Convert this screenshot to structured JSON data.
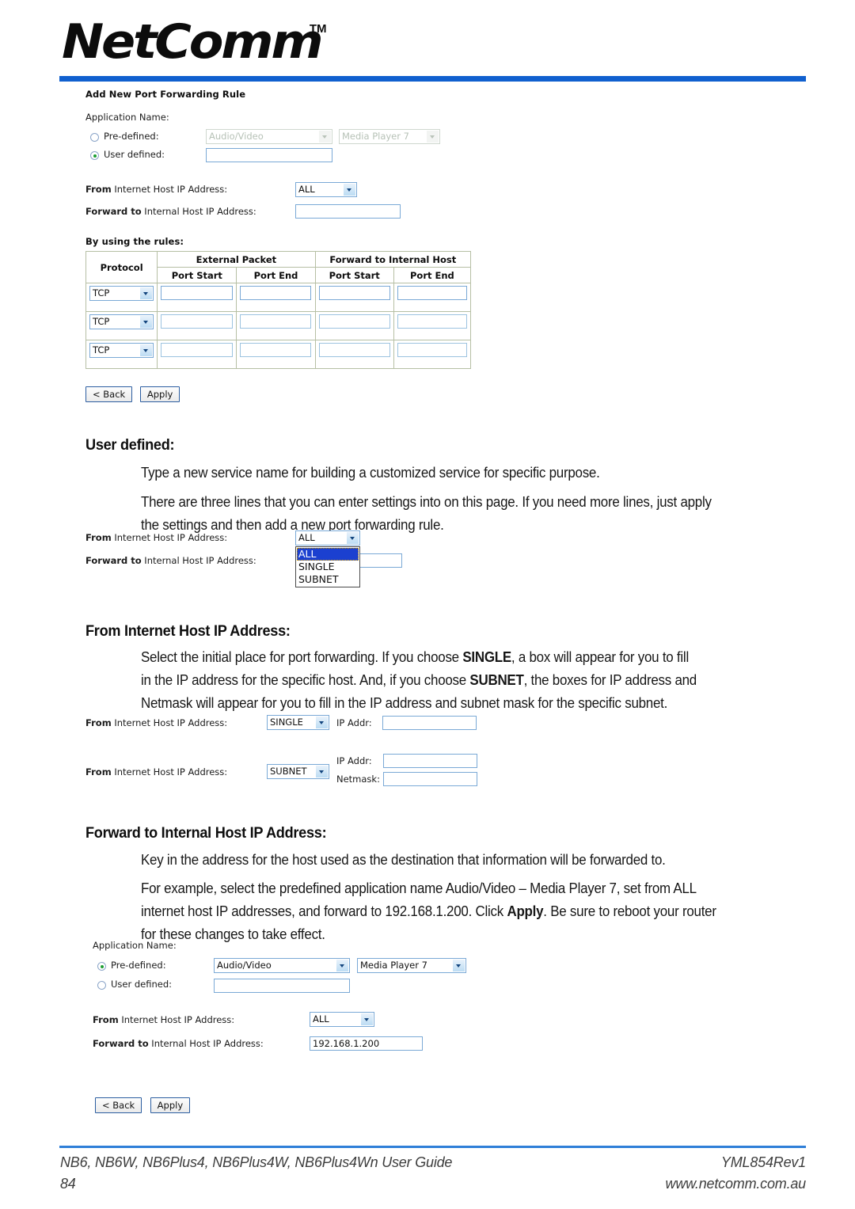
{
  "brand": {
    "logo_text": "NetComm",
    "trademark": "TM"
  },
  "form_top": {
    "title": "Add New Port Forwarding Rule",
    "app_name_label": "Application Name:",
    "predefined_label": "Pre-defined:",
    "predefined_selected": false,
    "predefined_category": "Audio/Video",
    "predefined_app": "Media Player 7",
    "user_defined_label": "User defined:",
    "user_defined_selected": true,
    "user_defined_value": "",
    "from_label_bold": "From",
    "from_label_rest": " Internet Host IP Address:",
    "from_value": "ALL",
    "forward_label_bold": "Forward to",
    "forward_label_rest": " Internal Host IP Address:",
    "forward_value": "",
    "rules_caption": "By using the rules:",
    "table": {
      "col_protocol": "Protocol",
      "group_external": "External Packet",
      "group_internal": "Forward to Internal Host",
      "sub_headers": [
        "Port Start",
        "Port End",
        "Port Start",
        "Port End"
      ],
      "rows": [
        {
          "protocol": "TCP",
          "ext_start": "",
          "ext_end": "",
          "int_start": "",
          "int_end": ""
        },
        {
          "protocol": "TCP",
          "ext_start": "",
          "ext_end": "",
          "int_start": "",
          "int_end": ""
        },
        {
          "protocol": "TCP",
          "ext_start": "",
          "ext_end": "",
          "int_start": "",
          "int_end": ""
        }
      ]
    },
    "back_button": "< Back",
    "apply_button": "Apply"
  },
  "section_user_defined": {
    "heading": "User defined:",
    "para1": "Type a new service name for building a customized service for specific purpose.",
    "para2_line1": "There are three lines that you can enter settings into on this page. If you need more lines, just apply",
    "para2_line2": "the settings and then add a new port forwarding rule."
  },
  "form_dropdown": {
    "from_label_bold": "From",
    "from_label_rest": " Internet Host IP Address:",
    "from_value": "ALL",
    "forward_label_bold": "Forward to",
    "forward_label_rest": " Internal Host IP Address:",
    "forward_value": "",
    "options": [
      "ALL",
      "SINGLE",
      "SUBNET"
    ],
    "highlighted_option": "ALL"
  },
  "section_from_internet": {
    "heading": "From Internet Host IP Address:",
    "line1_a": "Select the initial place for port forwarding. If you choose ",
    "line1_b": "SINGLE",
    "line1_c": ", a box will appear for you to fill",
    "line2_a": "in the IP address for the specific host. And, if you choose ",
    "line2_b": "SUBNET",
    "line2_c": ", the boxes for IP address and",
    "line3": "Netmask will appear for you to fill in the IP address and subnet mask for the specific subnet."
  },
  "form_single": {
    "from_label_bold": "From",
    "from_label_rest": " Internet Host IP Address:",
    "from_value": "SINGLE",
    "ip_addr_label": "IP Addr:",
    "ip_addr_value": ""
  },
  "form_subnet": {
    "from_label_bold": "From",
    "from_label_rest": " Internet Host IP Address:",
    "from_value": "SUBNET",
    "ip_addr_label": "IP Addr:",
    "ip_addr_value": "",
    "netmask_label": "Netmask:",
    "netmask_value": ""
  },
  "section_forward_to": {
    "heading": "Forward to Internal Host IP Address:",
    "para1": "Key in the address for the host used as the destination that information will be forwarded to.",
    "para2_line1": "For example, select the predefined application name Audio/Video – Media Player 7, set from ALL",
    "para2_line2_a": "internet host IP addresses, and forward to 192.168.1.200. Click ",
    "para2_line2_b": "Apply",
    "para2_line2_c": ". Be sure to reboot your router",
    "para2_line3": "for these changes to take effect."
  },
  "form_bottom": {
    "app_name_label": "Application Name:",
    "predefined_label": "Pre-defined:",
    "predefined_selected": true,
    "predefined_category": "Audio/Video",
    "predefined_app": "Media Player 7",
    "user_defined_label": "User defined:",
    "user_defined_selected": false,
    "user_defined_value": "",
    "from_label_bold": "From",
    "from_label_rest": " Internet Host IP Address:",
    "from_value": "ALL",
    "forward_label_bold": "Forward to",
    "forward_label_rest": " Internal Host IP Address:",
    "forward_value": "192.168.1.200",
    "back_button": "< Back",
    "apply_button": "Apply"
  },
  "footer": {
    "left_line1": "NB6, NB6W, NB6Plus4, NB6Plus4W, NB6Plus4Wn User Guide",
    "left_line2": "84",
    "right_line1": "YML854Rev1",
    "right_line2": "www.netcomm.com.au"
  }
}
